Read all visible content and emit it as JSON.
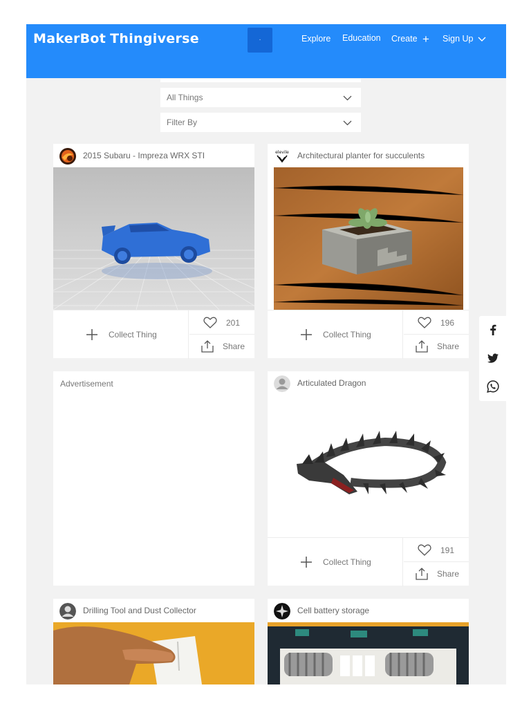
{
  "header": {
    "logo_left": "MakerBot",
    "logo_right": "Thingiverse",
    "search_button": "·",
    "nav": {
      "explore": "Explore",
      "education": "Education",
      "create": "Create",
      "signup": "Sign Up"
    }
  },
  "filters": {
    "type_select": "All Things",
    "filter_select": "Filter By"
  },
  "cards": [
    {
      "title": "2015 Subaru - Impreza WRX STI",
      "collect": "Collect Thing",
      "likes": "201",
      "share": "Share"
    },
    {
      "title": "Architectural planter for succulents",
      "avatar_text": "elevile",
      "collect": "Collect Thing",
      "likes": "196",
      "share": "Share"
    },
    {
      "title": "Articulated Dragon",
      "collect": "Collect Thing",
      "likes": "191",
      "share": "Share"
    },
    {
      "title": "Drilling Tool and Dust Collector"
    },
    {
      "title": "Cell battery storage"
    }
  ],
  "advertisement": {
    "label": "Advertisement"
  },
  "colors": {
    "brand_blue": "#248bfb",
    "search_button": "#1467d6",
    "background": "#f2f2f2"
  },
  "social_icons": [
    "facebook-icon",
    "twitter-icon",
    "whatsapp-icon"
  ]
}
